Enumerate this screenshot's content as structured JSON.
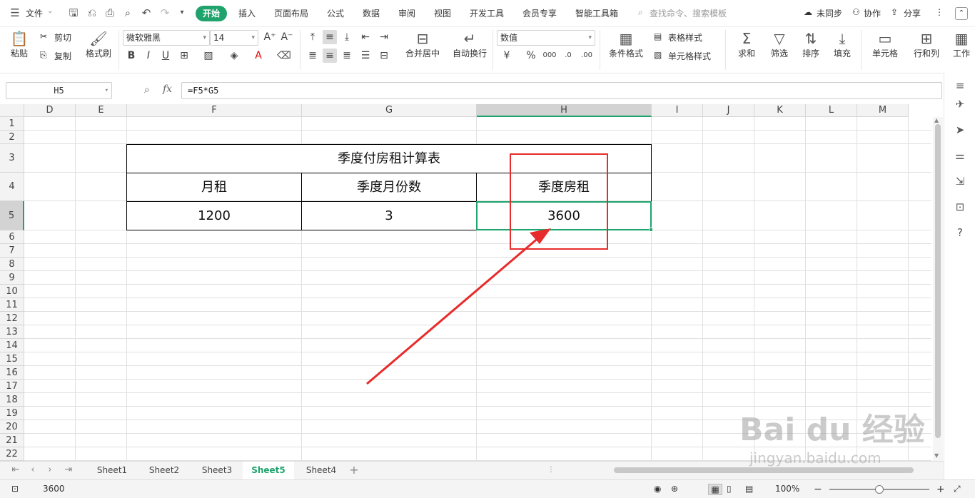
{
  "menubar": {
    "file_label": "文件",
    "tabs": [
      "开始",
      "插入",
      "页面布局",
      "公式",
      "数据",
      "审阅",
      "视图",
      "开发工具",
      "会员专享",
      "智能工具箱"
    ],
    "search_placeholder": "查找命令、搜索模板",
    "sync_label": "未同步",
    "collab_label": "协作",
    "share_label": "分享"
  },
  "ribbon": {
    "paste": "粘贴",
    "cut": "剪切",
    "copy": "复制",
    "format_painter": "格式刷",
    "font_name": "微软雅黑",
    "font_size": "14",
    "bold": "B",
    "italic": "I",
    "underline": "U",
    "merge_center": "合并居中",
    "wrap_text": "自动换行",
    "number_format": "数值",
    "conditional_format": "条件格式",
    "table_style": "表格样式",
    "cell_style": "单元格样式",
    "sum": "求和",
    "filter": "筛选",
    "sort": "排序",
    "fill": "填充",
    "cells": "单元格",
    "rows_cols": "行和列",
    "worksheet": "工作"
  },
  "formula_bar": {
    "name_box": "H5",
    "fx": "fx",
    "formula": "=F5*G5"
  },
  "grid": {
    "columns": [
      "D",
      "E",
      "F",
      "G",
      "H",
      "I",
      "J",
      "K",
      "L",
      "M"
    ],
    "rows": [
      "1",
      "2",
      "3",
      "4",
      "5",
      "6",
      "7",
      "8",
      "9",
      "10",
      "11",
      "12",
      "13",
      "14",
      "15",
      "16",
      "17",
      "18",
      "19",
      "20",
      "21",
      "22"
    ],
    "active_column": "H",
    "active_row": "5"
  },
  "table": {
    "title": "季度付房租计算表",
    "headers": [
      "月租",
      "季度月份数",
      "季度房租"
    ],
    "values": [
      "1200",
      "3",
      "3600"
    ]
  },
  "sheets": {
    "tabs": [
      "Sheet1",
      "Sheet2",
      "Sheet3",
      "Sheet5",
      "Sheet4"
    ],
    "active": "Sheet5"
  },
  "statusbar": {
    "value": "3600",
    "zoom": "100%"
  },
  "watermark": {
    "text": "Bai du 经验",
    "sub": "jingyan.baidu.com"
  },
  "colors": {
    "accent": "#1ea36c",
    "annotation": "#e82b2b"
  }
}
